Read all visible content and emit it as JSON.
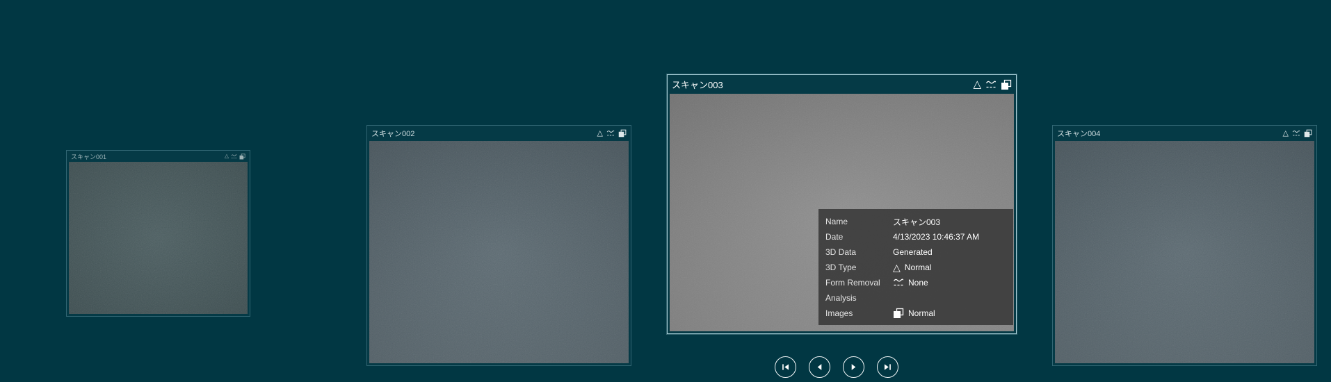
{
  "colors": {
    "background": "#013743",
    "selected_card_border": "#aad0da",
    "tooltip_background": "#404040",
    "nav_icon": "#ffffff"
  },
  "icons": {
    "triangle": "△",
    "form_removal": "form-removal-wave-icon",
    "images": "overlapping-frames-icon"
  },
  "cards": [
    {
      "title": "スキャン001",
      "selected": false
    },
    {
      "title": "スキャン002",
      "selected": false
    },
    {
      "title": "スキャン003",
      "selected": true
    },
    {
      "title": "スキャン004",
      "selected": false
    }
  ],
  "tooltip": {
    "rows": [
      {
        "label": "Name",
        "value": "スキャン003"
      },
      {
        "label": "Date",
        "value": "4/13/2023 10:46:37 AM"
      },
      {
        "label": "3D Data",
        "value": "Generated"
      },
      {
        "label": "3D Type",
        "value": "Normal",
        "icon": "3d-type-triangle"
      },
      {
        "label": "Form Removal",
        "value": "None",
        "icon": "form-removal"
      },
      {
        "label": "Analysis",
        "value": ""
      },
      {
        "label": "Images",
        "value": "Normal",
        "icon": "images"
      }
    ]
  },
  "nav": {
    "first": "First",
    "previous": "Previous",
    "next": "Next",
    "last": "Last"
  }
}
